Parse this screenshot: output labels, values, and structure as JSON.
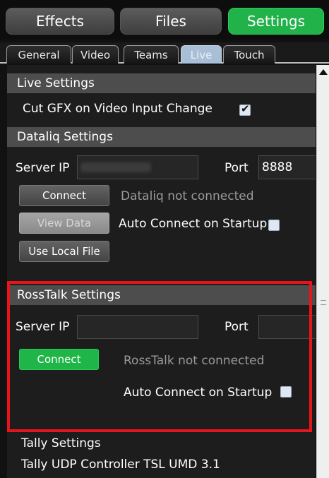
{
  "main_tabs": [
    {
      "label": "Effects"
    },
    {
      "label": "Files"
    },
    {
      "label": "Settings",
      "active": true
    }
  ],
  "sub_tabs": [
    {
      "label": "General"
    },
    {
      "label": "Video"
    },
    {
      "label": "Teams"
    },
    {
      "label": "Live",
      "active": true
    },
    {
      "label": "Touch"
    }
  ],
  "live_settings": {
    "header": "Live Settings",
    "cut_gfx_label": "Cut GFX on Video Input Change",
    "cut_gfx_checked": true
  },
  "datalinq": {
    "header": "Dataliq Settings",
    "server_ip_label": "Server IP",
    "port_label": "Port",
    "port_value": "8888",
    "connect_label": "Connect",
    "status_text": "Dataliq not connected",
    "view_data_label": "View Data",
    "auto_connect_label": "Auto Connect on Startup",
    "auto_connect_checked": false,
    "use_local_file_label": "Use Local File"
  },
  "rosstalk": {
    "header": "RossTalk Settings",
    "server_ip_label": "Server IP",
    "port_label": "Port",
    "connect_label": "Connect",
    "status_text": "RossTalk not connected",
    "auto_connect_label": "Auto Connect on Startup",
    "auto_connect_checked": false
  },
  "tally": {
    "header": "Tally Settings",
    "controller_label": "Tally UDP Controller TSL UMD 3.1"
  },
  "colors": {
    "accent_green": "#22b24a",
    "highlight_red": "#e8141b",
    "active_subtab": "#a8bfd7"
  }
}
